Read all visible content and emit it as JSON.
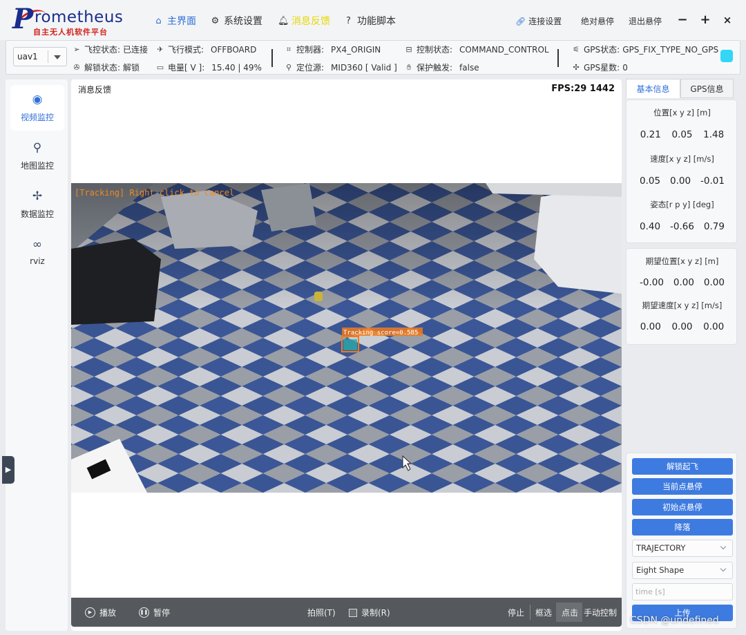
{
  "app": {
    "logo_text": "Prometheus",
    "logo_subtitle": "自主无人机软件平台"
  },
  "nav": {
    "home": "主界面",
    "system_settings": "系统设置",
    "message_feedback": "消息反馈",
    "function_scripts": "功能脚本"
  },
  "titlebar": {
    "connection_settings": "连接设置",
    "absolute_hover": "绝对悬停",
    "exit_hover": "退出悬停"
  },
  "status": {
    "uav_selected": "uav1",
    "fc_state_label": "飞控状态:",
    "fc_state_value": "已连接",
    "arm_state_label": "解锁状态:",
    "arm_state_value": "解锁",
    "flight_mode_label": "飞行模式:",
    "flight_mode_value": "OFFBOARD",
    "battery_label": "电量[ V ]:",
    "battery_value": "15.40 | 49%",
    "controller_label": "控制器:",
    "controller_value": "PX4_ORIGIN",
    "location_src_label": "定位源:",
    "location_src_value": "MID360 [ Valid ]",
    "control_state_label": "控制状态:",
    "control_state_value": "COMMAND_CONTROL",
    "protection_label": "保护触发:",
    "protection_value": "false",
    "gps_state_label": "GPS状态:",
    "gps_state_value": "GPS_FIX_TYPE_NO_GPS",
    "gps_sat_label": "GPS星数:",
    "gps_sat_value": "0",
    "gps_led_color": "#33d6f5"
  },
  "sidebar": {
    "items": [
      {
        "label": "视频监控",
        "icon": "camera-icon"
      },
      {
        "label": "地图监控",
        "icon": "map-pin-icon"
      },
      {
        "label": "数据监控",
        "icon": "drone-icon"
      },
      {
        "label": "rviz",
        "icon": "rviz-icon"
      }
    ]
  },
  "video": {
    "title": "消息反馈",
    "fps": "FPS:29  1442",
    "overlay_text": "[Tracking] Right click to cancel",
    "tracking_label": "Tracking  score=0.585"
  },
  "video_bar": {
    "play": "播放",
    "pause": "暂停",
    "photo": "拍照(T)",
    "record": "录制(R)",
    "stop": "停止",
    "box_select": "框选",
    "click": "点击",
    "manual_control": "手动控制"
  },
  "right_tabs": {
    "basic": "基本信息",
    "gps": "GPS信息"
  },
  "basic_info": {
    "position_label": "位置[x y z] [m]",
    "position": [
      "0.21",
      "0.05",
      "1.48"
    ],
    "velocity_label": "速度[x y z] [m/s]",
    "velocity": [
      "0.05",
      "0.00",
      "-0.01"
    ],
    "attitude_label": "姿态[r p y] [deg]",
    "attitude": [
      "0.40",
      "-0.66",
      "0.79"
    ]
  },
  "desired": {
    "position_label": "期望位置[x y z] [m]",
    "position": [
      "-0.00",
      "0.00",
      "0.00"
    ],
    "velocity_label": "期望速度[x y z] [m/s]",
    "velocity": [
      "0.00",
      "0.00",
      "0.00"
    ]
  },
  "controls": {
    "arm_takeoff": "解锁起飞",
    "hover_current": "当前点悬停",
    "hover_initial": "初始点悬停",
    "land": "降落",
    "mode_select": "TRAJECTORY",
    "shape_select": "Eight Shape",
    "time_placeholder": "time [s]",
    "upload": "上传",
    "accent_color": "#3e7be0"
  },
  "watermark": "CSDN @undefined"
}
